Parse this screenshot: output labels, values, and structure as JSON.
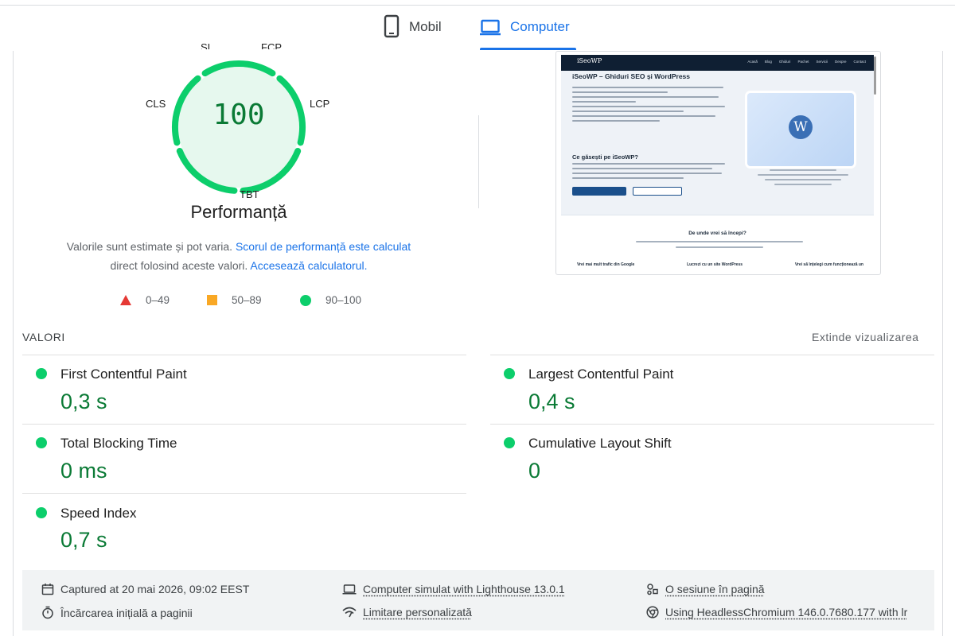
{
  "tabs": [
    {
      "label": "Mobil",
      "icon": "phone-icon",
      "selected": false
    },
    {
      "label": "Computer",
      "icon": "laptop-icon",
      "selected": true
    }
  ],
  "gauge": {
    "score": "100",
    "score_value": 100,
    "labels": {
      "si": "SI",
      "fcp": "FCP",
      "lcp": "LCP",
      "tbt": "TBT",
      "cls": "CLS"
    },
    "title": "Performanță",
    "color": "#0cce6b"
  },
  "description": {
    "text1": "Valorile sunt estimate și pot varia.",
    "link1": "Scorul de performanță este calculat",
    "text2": "direct folosind aceste valori.",
    "link2": "Accesează calculatorul."
  },
  "legend": [
    {
      "range": "0–49",
      "shape": "triangle",
      "color": "#e53935"
    },
    {
      "range": "50–89",
      "shape": "square",
      "color": "#f9a825"
    },
    {
      "range": "90–100",
      "shape": "circle",
      "color": "#0cce6b"
    }
  ],
  "screenshot": {
    "logo": "iSeoWP",
    "menu": [
      "Acasă",
      "Blog",
      "Ghiduri",
      "Pachet",
      "Servicii",
      "Despre",
      "Contact"
    ],
    "heading": "iSeoWP – Ghiduri SEO și WordPress",
    "subheading": "Ce găsești pe iSeoWP?",
    "section_title": "De unde vrei să începi?",
    "columns": [
      "Vrei mai mult trafic din Google",
      "Lucrezi cu un site WordPress",
      "Vrei să înțelegi cum funcționează un"
    ]
  },
  "metrics": {
    "title": "VALORI",
    "expand_label": "Extinde vizualizarea",
    "items": [
      {
        "name": "First Contentful Paint",
        "value": "0,3 s",
        "status": "pass"
      },
      {
        "name": "Largest Contentful Paint",
        "value": "0,4 s",
        "status": "pass"
      },
      {
        "name": "Total Blocking Time",
        "value": "0 ms",
        "status": "pass"
      },
      {
        "name": "Cumulative Layout Shift",
        "value": "0",
        "status": "pass"
      },
      {
        "name": "Speed Index",
        "value": "0,7 s",
        "status": "pass"
      }
    ]
  },
  "footer": {
    "captured": "Captured at 20 mai 2026, 09:02 EEST",
    "device": "Computer simulat with Lighthouse 13.0.1",
    "session": "O sesiune în pagină",
    "load": "Încărcarea inițială a paginii",
    "throttle": "Limitare personalizată",
    "browser": "Using HeadlessChromium 146.0.7680.177 with lr"
  }
}
